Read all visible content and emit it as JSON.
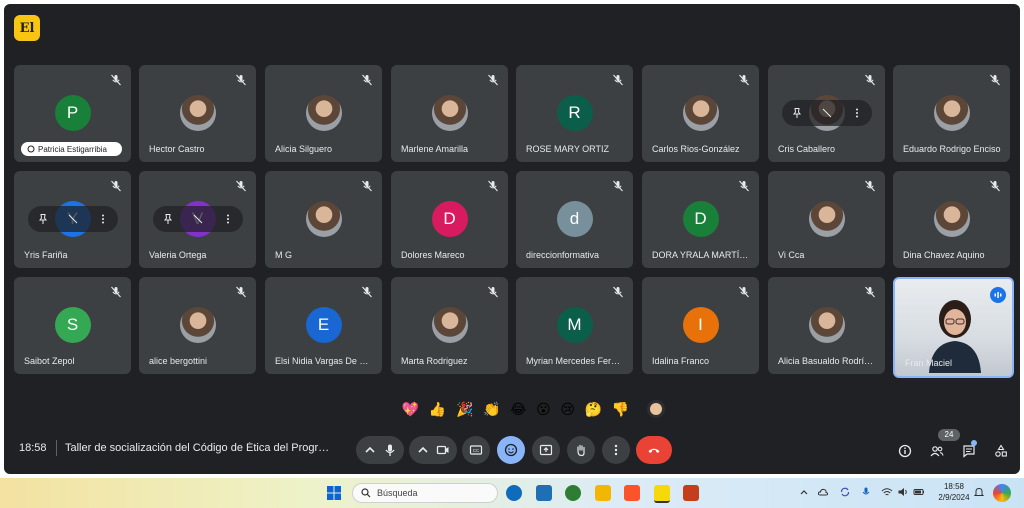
{
  "app": {
    "logo_text": "El",
    "logo_color": "#f9c513"
  },
  "participants": [
    {
      "name": "Patricia Estigarribia",
      "initial": "P",
      "color": "#188038",
      "pinned_label": true
    },
    {
      "name": "Hector Castro",
      "photo": true
    },
    {
      "name": "Alicia Silguero",
      "photo": true
    },
    {
      "name": "Marlene Amarilla",
      "photo": true
    },
    {
      "name": "ROSE MARY ORTIZ",
      "initial": "R",
      "color": "#0b5e4a"
    },
    {
      "name": "Carlos Rios-González",
      "photo": true
    },
    {
      "name": "Cris Caballero",
      "photo": true,
      "hover_controls": true
    },
    {
      "name": "Eduardo Rodrigo Enciso",
      "photo": true
    },
    {
      "name": "Yris Fariña",
      "initial": "Y",
      "color": "#1a73e8",
      "hover_controls": true
    },
    {
      "name": "Valeria Ortega",
      "initial": "V",
      "color": "#8430ce",
      "hover_controls": true
    },
    {
      "name": "M G",
      "photo": true
    },
    {
      "name": "Dolores Mareco",
      "initial": "D",
      "color": "#d81b60"
    },
    {
      "name": "direccionformativa",
      "initial": "d",
      "color": "#78909c"
    },
    {
      "name": "DORA YRALA MARTÍNEZ",
      "initial": "D",
      "color": "#188038"
    },
    {
      "name": "Vi Cca",
      "photo": true
    },
    {
      "name": "Dina Chavez Aquino",
      "photo": true
    },
    {
      "name": "Saibot Zepol",
      "initial": "S",
      "color": "#34a853"
    },
    {
      "name": "alice bergottini",
      "photo": true
    },
    {
      "name": "Elsi Nidia Vargas De Meza",
      "initial": "E",
      "color": "#1967d2"
    },
    {
      "name": "Marta Rodriguez",
      "photo": true
    },
    {
      "name": "Myrian Mercedes Fernández",
      "initial": "M",
      "color": "#0b5e4a"
    },
    {
      "name": "Idalina Franco",
      "initial": "I",
      "color": "#e8710a"
    },
    {
      "name": "Alicia Basualdo Rodríguez",
      "photo": true
    },
    {
      "name": "Fran Maciel",
      "self": true
    }
  ],
  "reactions": [
    "💖",
    "👍",
    "🎉",
    "👏",
    "😂",
    "😮",
    "😢",
    "🤔",
    "👎"
  ],
  "meeting": {
    "time": "18:58",
    "title": "Taller de socialización del Código de Ética del Programa"
  },
  "people_count": "24",
  "taskbar": {
    "search_placeholder": "Búsqueda",
    "time": "18:58",
    "date": "2/9/2024"
  }
}
